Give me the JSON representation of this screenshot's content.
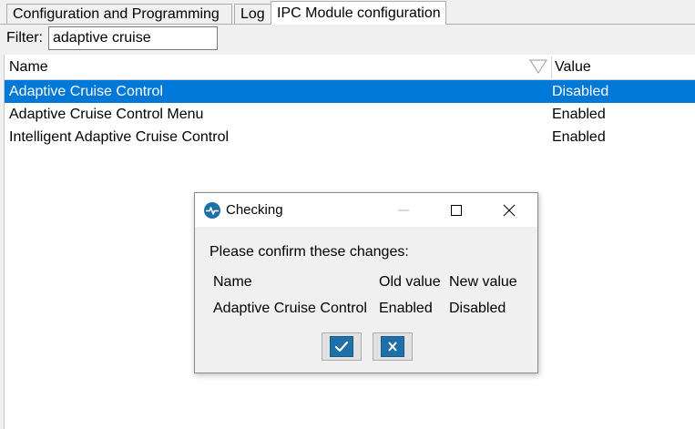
{
  "tabs": [
    {
      "label": "Configuration and Programming"
    },
    {
      "label": "Log"
    },
    {
      "label": "IPC Module configuration",
      "active": true
    }
  ],
  "filter": {
    "label": "Filter:",
    "value": "adaptive cruise"
  },
  "table": {
    "columns": [
      "Name",
      "Value"
    ],
    "rows": [
      {
        "name": "Adaptive Cruise Control",
        "value": "Disabled",
        "selected": true
      },
      {
        "name": "Adaptive Cruise Control Menu",
        "value": "Enabled"
      },
      {
        "name": "Intelligent Adaptive Cruise Control",
        "value": "Enabled"
      }
    ]
  },
  "dialog": {
    "title": "Checking",
    "message": "Please confirm these changes:",
    "columns": [
      "Name",
      "Old value",
      "New value"
    ],
    "rows": [
      {
        "name": "Adaptive Cruise Control",
        "old": "Enabled",
        "new": "Disabled"
      }
    ],
    "icons": {
      "app": "pulse-icon",
      "confirm": "check-icon",
      "cancel": "x-icon"
    }
  },
  "colors": {
    "selection": "#0078d7",
    "button_face": "#1f6fa8",
    "app_icon": "#1f6fa8"
  }
}
